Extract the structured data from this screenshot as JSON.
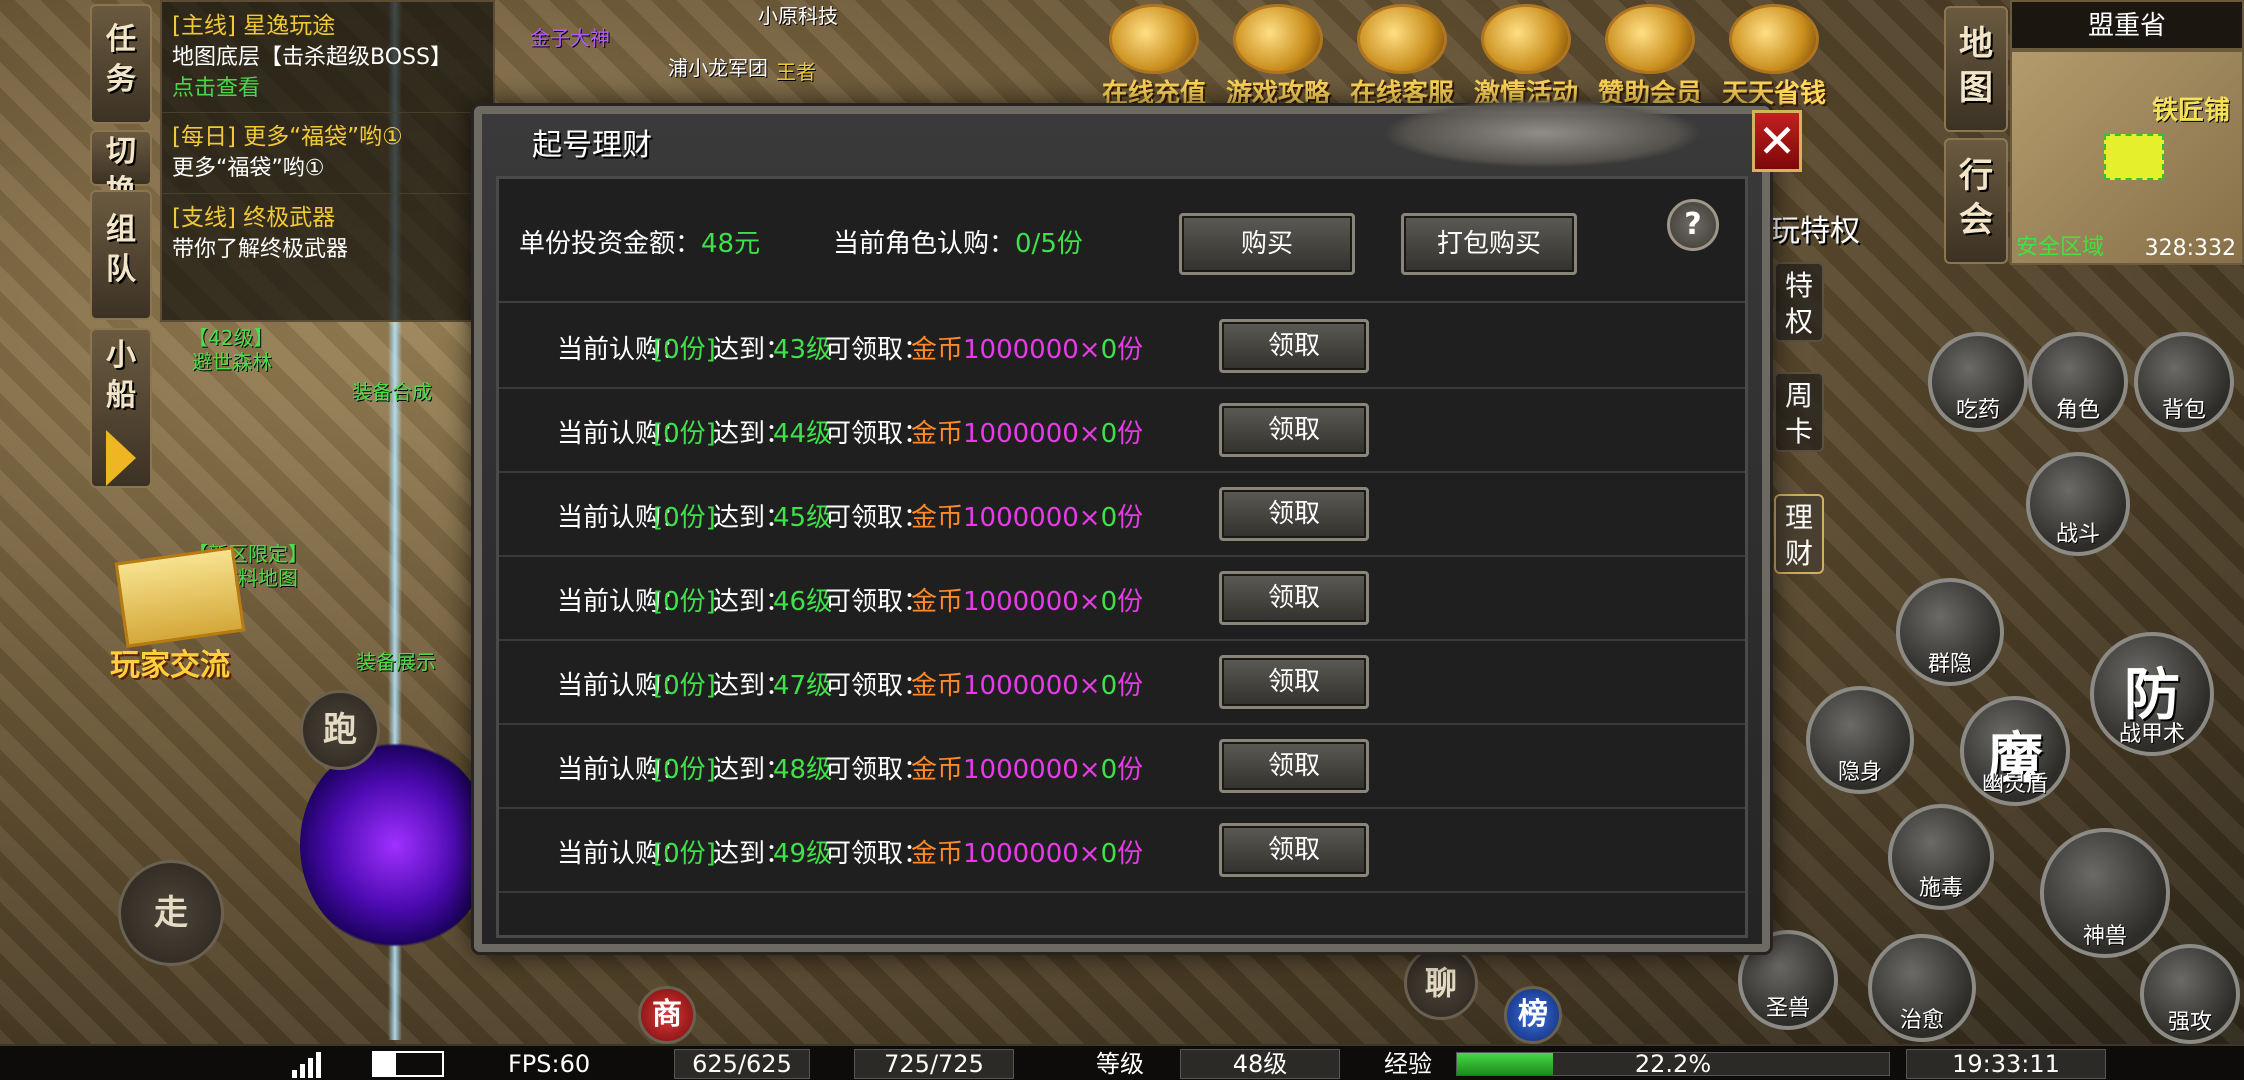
{
  "hud": {
    "tabs_left": [
      "任务",
      "切换",
      "组队",
      "小船"
    ],
    "quests": [
      {
        "title": "[主线] 星逸玩途",
        "desc": "地图底层【击杀超级BOSS】",
        "link": "点击查看"
      },
      {
        "title": "[每日] 更多“福袋”哟①",
        "desc": "更多“福袋”哟①",
        "link": ""
      },
      {
        "title": "[支线] 终极武器",
        "desc": "带你了解终极武器",
        "link": ""
      }
    ],
    "events": [
      "在线充值",
      "游戏攻略",
      "在线客服",
      "激情活动",
      "赞助会员",
      "天天省钱"
    ],
    "minimap": {
      "region": "盟重省",
      "poi": "铁匠铺",
      "safe": "安全区域",
      "coord": "328:332"
    },
    "right_tabs": [
      "地图",
      "行会"
    ],
    "mid_tabs": [
      "特权",
      "周卡",
      "理财"
    ],
    "play_privilege_text": "玩特权",
    "skills": {
      "drug": "吃药",
      "role": "角色",
      "bag": "背包",
      "fight": "战斗",
      "hide": "群隐",
      "hide2": "隐身",
      "fang": "防",
      "fang_sub": "战甲术",
      "mo": "魔",
      "mo_sub": "幽灵盾",
      "poison": "施毒",
      "heal": "治愈",
      "pet": "圣兽",
      "beast": "神兽",
      "strong": "强攻"
    },
    "left_buttons": {
      "trade": "玩家交流",
      "run": "跑",
      "walk": "走"
    },
    "bottom_buttons": {
      "shop": "商",
      "rank": "榜",
      "chat": "聊"
    },
    "world_labels": {
      "forest": "避世森林",
      "level_tag": "【42级】",
      "equip_synth": "装备合成",
      "new_area": "【新区限定】",
      "material_map": "材料地图",
      "equip_show": "装备展示",
      "sword_god": "金子大神",
      "xiaoyuan": "小原科技",
      "dragon_army": "浦小龙军团",
      "king": "王者"
    }
  },
  "dialog": {
    "title": "起号理财",
    "close": "✕",
    "help": "?",
    "unit_amount_label": "单份投资金额：",
    "unit_amount_value": "48元",
    "current_sub_label": "当前角色认购：",
    "current_sub_value": "0/5份",
    "buy_label": "购买",
    "pack_buy_label": "打包购买",
    "rows": [
      {
        "sub_label": "当前认购：",
        "sub_value": "[0份]",
        "reach_label": "达到：",
        "level": "43级",
        "claim_label": "可领取：",
        "reward_a": "金币",
        "reward_b": "1000000×",
        "reward_c": "0",
        "reward_d": "份",
        "button": "领取"
      },
      {
        "sub_label": "当前认购：",
        "sub_value": "[0份]",
        "reach_label": "达到：",
        "level": "44级",
        "claim_label": "可领取：",
        "reward_a": "金币",
        "reward_b": "1000000×",
        "reward_c": "0",
        "reward_d": "份",
        "button": "领取"
      },
      {
        "sub_label": "当前认购：",
        "sub_value": "[0份]",
        "reach_label": "达到：",
        "level": "45级",
        "claim_label": "可领取：",
        "reward_a": "金币",
        "reward_b": "1000000×",
        "reward_c": "0",
        "reward_d": "份",
        "button": "领取"
      },
      {
        "sub_label": "当前认购：",
        "sub_value": "[0份]",
        "reach_label": "达到：",
        "level": "46级",
        "claim_label": "可领取：",
        "reward_a": "金币",
        "reward_b": "1000000×",
        "reward_c": "0",
        "reward_d": "份",
        "button": "领取"
      },
      {
        "sub_label": "当前认购：",
        "sub_value": "[0份]",
        "reach_label": "达到：",
        "level": "47级",
        "claim_label": "可领取：",
        "reward_a": "金币",
        "reward_b": "1000000×",
        "reward_c": "0",
        "reward_d": "份",
        "button": "领取"
      },
      {
        "sub_label": "当前认购：",
        "sub_value": "[0份]",
        "reach_label": "达到：",
        "level": "48级",
        "claim_label": "可领取：",
        "reward_a": "金币",
        "reward_b": "1000000×",
        "reward_c": "0",
        "reward_d": "份",
        "button": "领取"
      },
      {
        "sub_label": "当前认购：",
        "sub_value": "[0份]",
        "reach_label": "达到：",
        "level": "49级",
        "claim_label": "可领取：",
        "reward_a": "金币",
        "reward_b": "1000000×",
        "reward_c": "0",
        "reward_d": "份",
        "button": "领取"
      }
    ]
  },
  "status_bar": {
    "fps": "FPS:60",
    "hp": "625/625",
    "mp": "725/725",
    "level_label": "等级",
    "level_value": "48级",
    "exp_label": "经验",
    "exp_percent": "22.2%",
    "exp_fraction": 0.222,
    "time": "19:33:11"
  }
}
